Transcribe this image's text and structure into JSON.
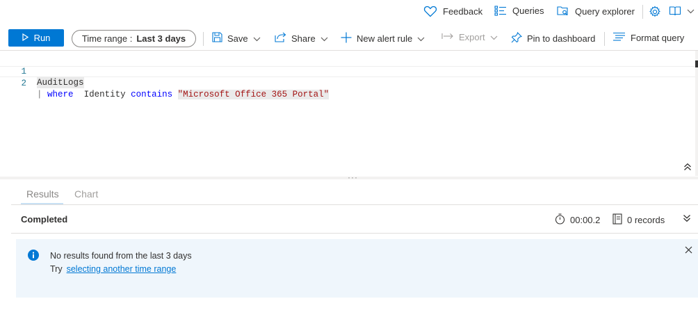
{
  "topbar": {
    "feedback": "Feedback",
    "queries": "Queries",
    "query_explorer": "Query explorer"
  },
  "toolbar": {
    "run": "Run",
    "time_range_label": "Time range :",
    "time_range_value": "Last 3 days",
    "save": "Save",
    "share": "Share",
    "new_alert_rule": "New alert rule",
    "export": "Export",
    "pin_to_dashboard": "Pin to dashboard",
    "format_query": "Format query"
  },
  "editor": {
    "lines": [
      {
        "number": "1",
        "text": "AuditLogs"
      },
      {
        "number": "2",
        "pipe": "|",
        "kw_where": "where",
        "field": "Identity",
        "kw_contains": "contains",
        "string": "\"Microsoft Office 365 Portal\""
      }
    ]
  },
  "results": {
    "tabs": [
      "Results",
      "Chart"
    ],
    "status": "Completed",
    "duration": "00:00.2",
    "records": "0 records",
    "message": "No results found from the last 3 days",
    "try_prefix": "Try",
    "try_link": "selecting another time range"
  },
  "colors": {
    "accent": "#0078d4",
    "info_background": "#eff6fc"
  }
}
